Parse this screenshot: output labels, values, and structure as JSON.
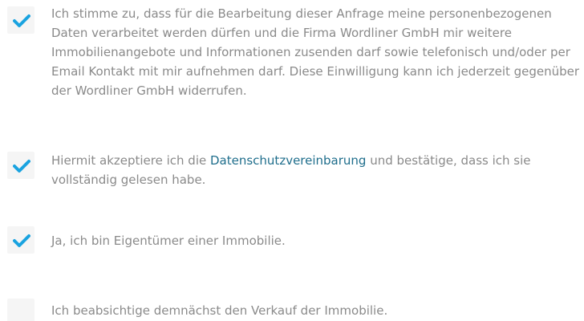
{
  "consents": [
    {
      "checked": true,
      "text": "Ich stimme zu, dass für die Bearbeitung dieser Anfrage meine personenbezogenen Daten verarbeitet werden dürfen und die Firma Wordliner GmbH mir weitere Immobilienangebote und Informationen zusenden darf sowie telefonisch und/oder per Email Kontakt mit mir aufnehmen darf. Diese Einwilligung kann ich jederzeit gegenüber der Wordliner GmbH widerrufen."
    },
    {
      "checked": true,
      "text_before": "Hiermit akzeptiere ich die ",
      "link_text": "Datenschutzvereinbarung",
      "text_after": " und bestätige, dass ich sie vollständig gelesen habe."
    },
    {
      "checked": true,
      "text": "Ja, ich bin Eigentümer einer Immobilie."
    },
    {
      "checked": false,
      "text": "Ich beabsichtige demnächst den Verkauf der Immobilie."
    }
  ],
  "colors": {
    "check": "#1aa3e0",
    "checkbox_bg": "#f5f5f5",
    "text": "#8a8a8a",
    "link": "#1f6e8c"
  },
  "icons": {
    "checked": "checkmark-icon"
  }
}
